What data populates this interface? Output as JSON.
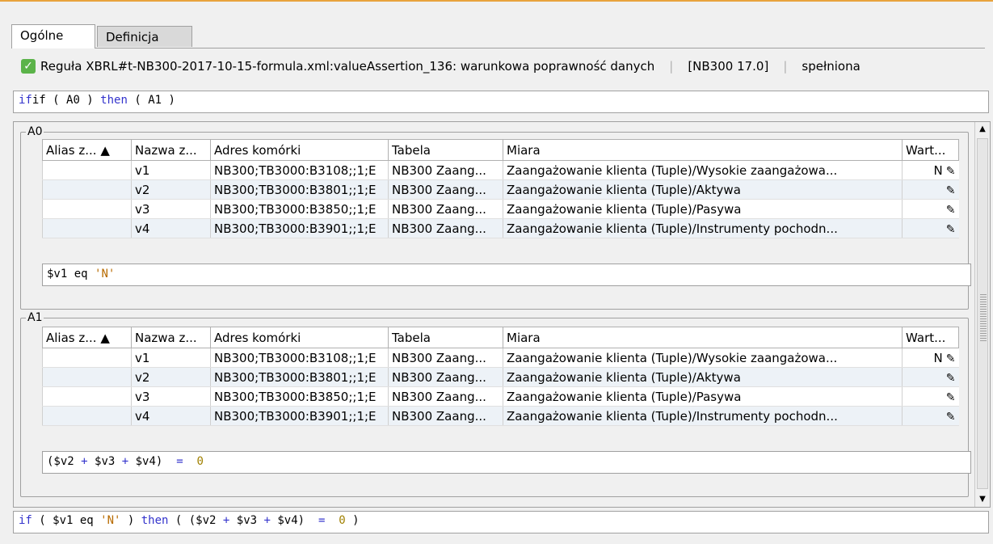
{
  "tabs": [
    {
      "label": "Ogólne"
    },
    {
      "label": "Definicja"
    }
  ],
  "status": {
    "rule": "Reguła XBRL#t-NB300-2017-10-15-formula.xml:valueAssertion_136: warunkowa poprawność danych",
    "version": "[NB300 17.0]",
    "result": "spełniona"
  },
  "condition": {
    "prefix": "if ( ",
    "a": "A0",
    "mid": " ) ",
    "then": "then",
    "open": " ( ",
    "b": "A1",
    "close": " )"
  },
  "columns": [
    "Alias z... ▲",
    "Nazwa z...",
    "Adres komórki",
    "Tabela",
    "Miara",
    "Wart..."
  ],
  "groups": [
    {
      "title": "A0",
      "rows": [
        {
          "alias": "",
          "name": "v1",
          "addr": "NB300;TB3000:B3108;;1;E",
          "table": "NB300 Zaang...",
          "measure": "Zaangażowanie klienta (Tuple)/Wysokie zaangażowa...",
          "value": "N"
        },
        {
          "alias": "",
          "name": "v2",
          "addr": "NB300;TB3000:B3801;;1;E",
          "table": "NB300 Zaang...",
          "measure": "Zaangażowanie klienta (Tuple)/Aktywa",
          "value": ""
        },
        {
          "alias": "",
          "name": "v3",
          "addr": "NB300;TB3000:B3850;;1;E",
          "table": "NB300 Zaang...",
          "measure": "Zaangażowanie klienta (Tuple)/Pasywa",
          "value": ""
        },
        {
          "alias": "",
          "name": "v4",
          "addr": "NB300;TB3000:B3901;;1;E",
          "table": "NB300 Zaang...",
          "measure": "Zaangażowanie klienta (Tuple)/Instrumenty pochodn...",
          "value": ""
        }
      ],
      "expr": {
        "p1": "$v1 eq ",
        "str": "'N'"
      }
    },
    {
      "title": "A1",
      "rows": [
        {
          "alias": "",
          "name": "v1",
          "addr": "NB300;TB3000:B3108;;1;E",
          "table": "NB300 Zaang...",
          "measure": "Zaangażowanie klienta (Tuple)/Wysokie zaangażowa...",
          "value": "N"
        },
        {
          "alias": "",
          "name": "v2",
          "addr": "NB300;TB3000:B3801;;1;E",
          "table": "NB300 Zaang...",
          "measure": "Zaangażowanie klienta (Tuple)/Aktywa",
          "value": ""
        },
        {
          "alias": "",
          "name": "v3",
          "addr": "NB300;TB3000:B3850;;1;E",
          "table": "NB300 Zaang...",
          "measure": "Zaangażowanie klienta (Tuple)/Pasywa",
          "value": ""
        },
        {
          "alias": "",
          "name": "v4",
          "addr": "NB300;TB3000:B3901;;1;E",
          "table": "NB300 Zaang...",
          "measure": "Zaangażowanie klienta (Tuple)/Instrumenty pochodn...",
          "value": ""
        }
      ],
      "expr": {
        "p1": "($v2 ",
        "plus1": "+",
        "p2": " $v3 ",
        "plus2": "+",
        "p3": " $v4)  ",
        "eq": "=",
        "sp": "  ",
        "zero": "0"
      }
    }
  ],
  "full": {
    "if": "if",
    "p1": " ( $v1 eq ",
    "str": "'N'",
    "p2": " ) ",
    "then": "then",
    "p3": " ( ($v2 ",
    "plus1": "+",
    "p4": " $v3 ",
    "plus2": "+",
    "p5": " $v4)  ",
    "eq": "=",
    "p6": "  ",
    "zero": "0",
    "p7": " )"
  }
}
